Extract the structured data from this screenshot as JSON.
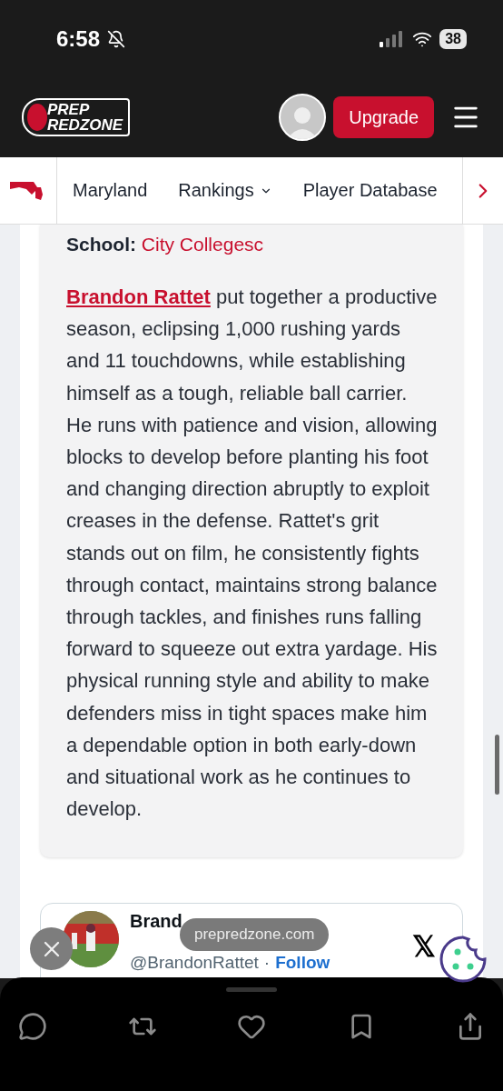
{
  "status_bar": {
    "time": "6:58",
    "battery": "38"
  },
  "header": {
    "logo_top": "PREP",
    "logo_bottom": "REDZONE",
    "upgrade": "Upgrade"
  },
  "nav": {
    "items": [
      {
        "label": "Maryland",
        "dropdown": false
      },
      {
        "label": "Rankings",
        "dropdown": true
      },
      {
        "label": "Player Database",
        "dropdown": false
      }
    ]
  },
  "article": {
    "school_label": "School:",
    "school": "City Collegesc",
    "bio_link": "Brandon Rattet",
    "bio_text": " put together a productive season, eclipsing 1,000 rushing yards and 11 touchdowns, while establishing himself as a tough, reliable ball carrier. He runs with patience and vision, allowing blocks to develop before planting his foot and changing direction abruptly to exploit creases in the defense. Rattet's grit stands out on film, he consistently fights through contact, maintains strong balance through tackles, and finishes runs falling forward to squeeze out extra yardage. His physical running style and ability to make defenders miss in tight spaces make him a dependable option in both early-down and situational work as he continues to develop."
  },
  "embed": {
    "name": "Brand",
    "handle": "@BrandonRattet",
    "separator": "·",
    "follow": "Follow",
    "source": "𝕏"
  },
  "browser": {
    "url": "prepredzone.com"
  }
}
